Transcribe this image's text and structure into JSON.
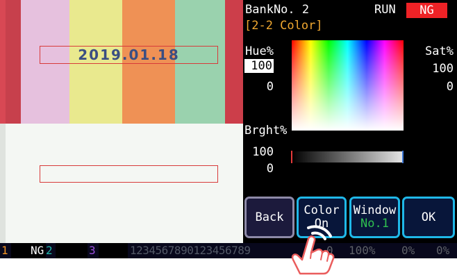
{
  "header": {
    "bank_label": "BankNo. 2",
    "run_status": "RUN",
    "judgment_badge": "NG",
    "screen_title": "[2-2 Color]"
  },
  "camera_view": {
    "date_text": "2019.01.18"
  },
  "hue": {
    "label": "Hue%",
    "max": "100",
    "min": "0"
  },
  "saturation": {
    "label": "Sat%",
    "max": "100",
    "min": "0"
  },
  "brightness": {
    "label": "Brght%",
    "max": "100",
    "min": "0"
  },
  "buttons": {
    "back": "Back",
    "color_line1": "Color",
    "color_line2": "On",
    "window_line1": "Window",
    "window_line2": "No.1",
    "ok": "OK"
  },
  "status_bar": {
    "ch1_num": "1",
    "ch1_status": "NG",
    "ch2_num": "2",
    "ch3_num": "3",
    "counter": "1234567890123456789",
    "hue_value": "0",
    "percent_values": [
      "100%",
      "0%",
      "0%"
    ]
  },
  "colors": {
    "accent_cyan": "#1fb8e8",
    "ng_red": "#ee2226",
    "title_orange": "#f0a830",
    "window_value_green": "#2fc050"
  },
  "icons": [
    "touch-hand-icon"
  ]
}
